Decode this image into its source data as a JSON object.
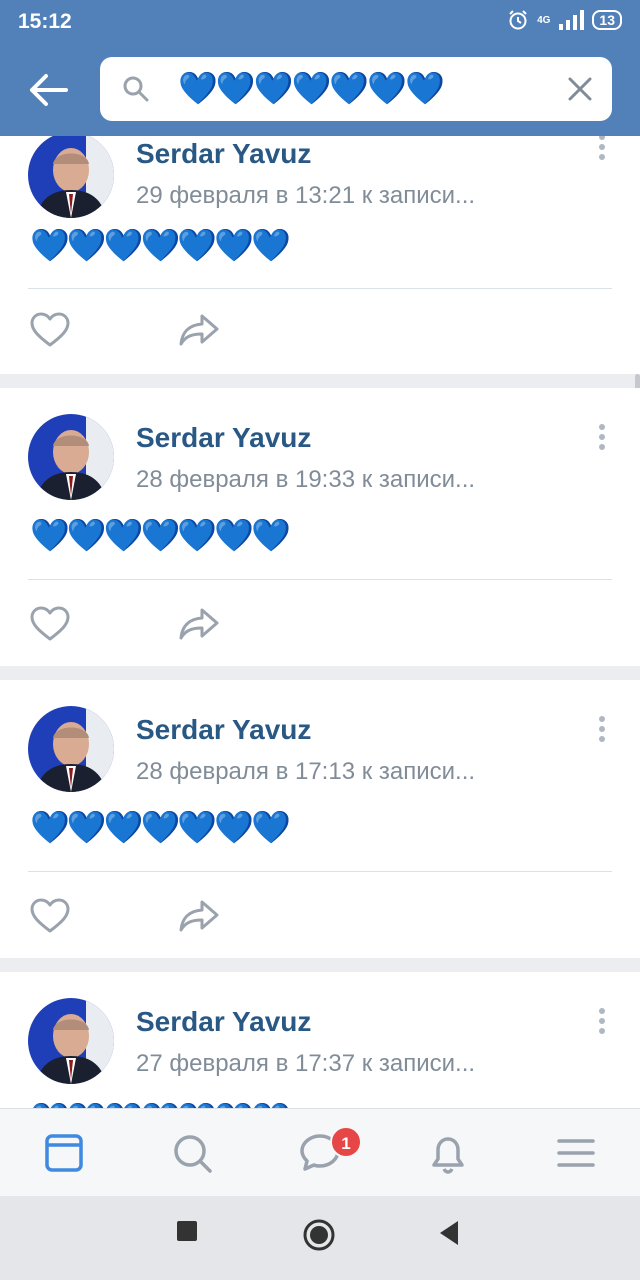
{
  "status_bar": {
    "time": "15:12",
    "network": "4G",
    "battery": "13"
  },
  "search": {
    "query": "💙💙💙💙💙💙💙"
  },
  "posts": [
    {
      "author": "Serdar Yavuz",
      "meta": "29 февраля в 13:21 к записи...",
      "text": "💙💙💙💙💙💙💙"
    },
    {
      "author": "Serdar Yavuz",
      "meta": "28 февраля в 19:33 к записи...",
      "text": "💙💙💙💙💙💙💙"
    },
    {
      "author": "Serdar Yavuz",
      "meta": "28 февраля в 17:13 к записи...",
      "text": "💙💙💙💙💙💙💙"
    },
    {
      "author": "Serdar Yavuz",
      "meta": "27 февраля в 17:37 к записи...",
      "text": "💙💙💙💙💙💙💙"
    }
  ],
  "tab_bar": {
    "tabs": [
      "news-icon",
      "search-icon",
      "messages-icon",
      "notifications-icon",
      "menu-icon"
    ],
    "messages_badge": "1"
  },
  "colors": {
    "header": "#5181b8",
    "author": "#2a5885",
    "meta": "#818c99",
    "badge": "#e64646"
  }
}
